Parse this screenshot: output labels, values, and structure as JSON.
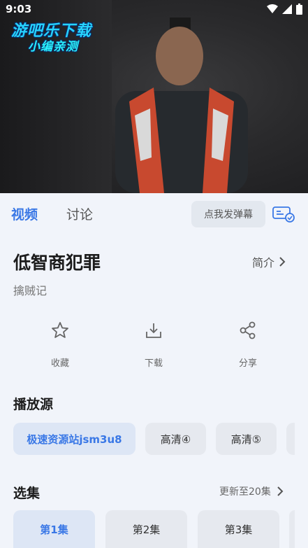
{
  "status": {
    "time": "9:03"
  },
  "watermark": {
    "line1": "游吧乐下载",
    "line2": "小编亲测"
  },
  "tabs": {
    "video": "视频",
    "discuss": "讨论",
    "danmu_button": "点我发弹幕"
  },
  "detail": {
    "title": "低智商犯罪",
    "intro_label": "简介",
    "subtitle": "擒贼记"
  },
  "actions": [
    {
      "label": "收藏",
      "icon": "star-icon"
    },
    {
      "label": "下载",
      "icon": "download-icon"
    },
    {
      "label": "分享",
      "icon": "share-icon"
    }
  ],
  "sources": {
    "heading": "播放源",
    "items": [
      "极速资源站jsm3u8",
      "高清④",
      "高清⑤"
    ],
    "selected_index": 0
  },
  "episodes": {
    "heading": "选集",
    "update_text": "更新至20集",
    "items": [
      "第1集",
      "第2集",
      "第3集"
    ],
    "selected_index": 0
  },
  "colors": {
    "accent": "#3a78e6",
    "background": "#f1f4fa",
    "chip": "#e6e9ef",
    "chip_selected": "#dde6f5"
  }
}
